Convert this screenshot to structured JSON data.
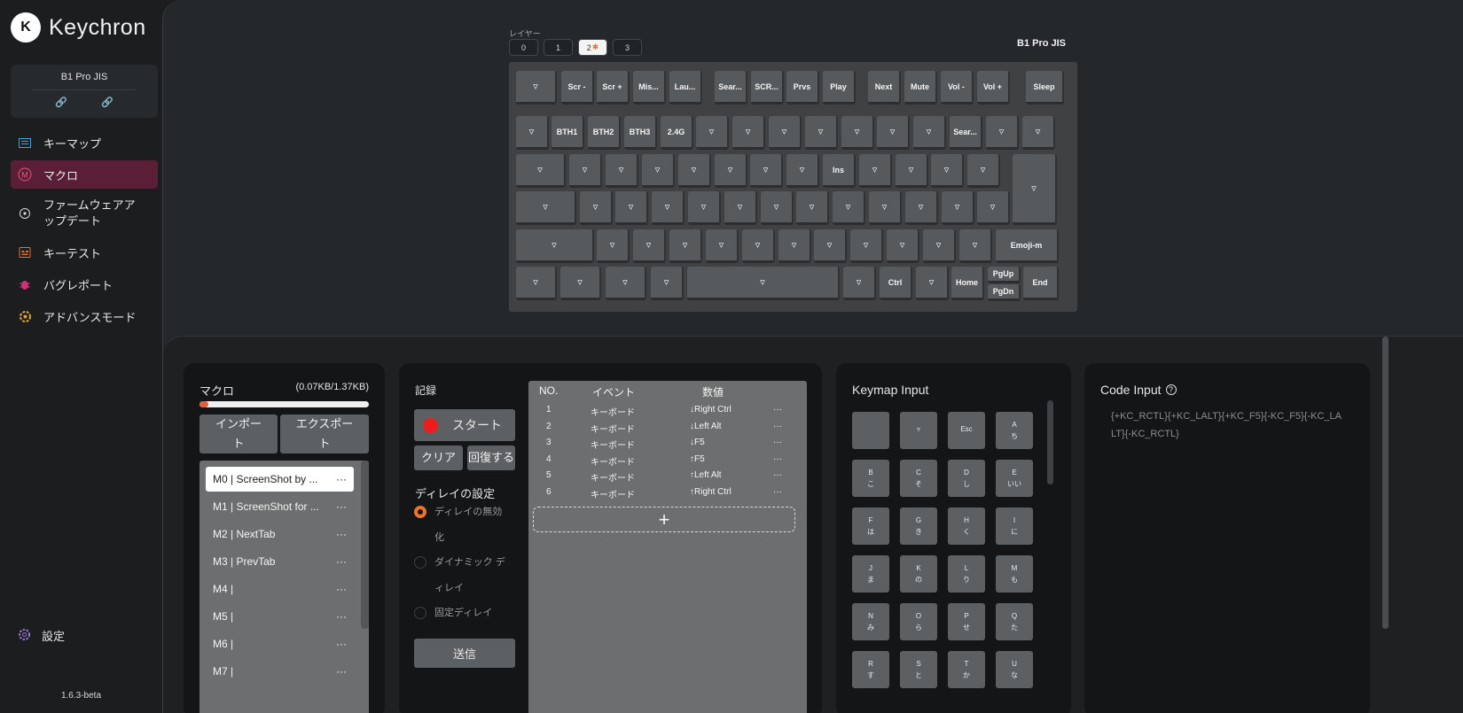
{
  "app": {
    "logo_glyph": "K",
    "brand": "Keychron",
    "version": "1.6.3-beta"
  },
  "device": {
    "name": "B1 Pro JIS",
    "link_icon_1": "🔗",
    "link_icon_2": "🔗"
  },
  "nav": [
    {
      "label": "キーマップ",
      "icon": "keymap-icon"
    },
    {
      "label": "マクロ",
      "icon": "macro-icon"
    },
    {
      "label": "ファームウェアアップデート",
      "icon": "firmware-icon"
    },
    {
      "label": "キーテスト",
      "icon": "keytest-icon"
    },
    {
      "label": "バグレポート",
      "icon": "bug-icon"
    },
    {
      "label": "アドバンスモード",
      "icon": "advanced-icon"
    }
  ],
  "settings_label": "設定",
  "layers": {
    "label": "レイヤー",
    "items": [
      "0",
      "1",
      "2",
      "3"
    ],
    "selected": "2",
    "modified_mark": "✱"
  },
  "board_title": "B1 Pro JIS",
  "keys": {
    "r1": [
      "▿",
      "Scr -",
      "Scr +",
      "Mis...",
      "Lau...",
      "Sear...",
      "SCR...",
      "Prvs",
      "Play",
      "Next",
      "Mute",
      "Vol -",
      "Vol +",
      "Sleep"
    ],
    "r2": [
      "▿",
      "BTH1",
      "BTH2",
      "BTH3",
      "2.4G",
      "▿",
      "▿",
      "▿",
      "▿",
      "▿",
      "▿",
      "▿",
      "Sear...",
      "▿",
      "▿"
    ],
    "r3": [
      "▿",
      "▿",
      "▿",
      "▿",
      "▿",
      "▿",
      "▿",
      "▿",
      "Ins",
      "▿",
      "▿",
      "▿",
      "▿"
    ],
    "enter": "▿",
    "r4": [
      "▿",
      "▿",
      "▿",
      "▿",
      "▿",
      "▿",
      "▿",
      "▿",
      "▿",
      "▿",
      "▿",
      "▿",
      "▿"
    ],
    "r5": [
      "▿",
      "▿",
      "▿",
      "▿",
      "▿",
      "▿",
      "▿",
      "▿",
      "▿",
      "▿",
      "▿",
      "▿",
      "Emoji-m"
    ],
    "r6": [
      "▿",
      "▿",
      "▿",
      "▿",
      "▿",
      "▿",
      "Ctrl",
      "▿",
      "Home",
      "PgUp",
      "PgDn",
      "End"
    ]
  },
  "macro": {
    "title": "マクロ",
    "size": "(0.07KB/1.37KB)",
    "usage_fraction": 0.05,
    "import_label": "インポート",
    "export_label": "エクスポート",
    "items": [
      {
        "name": "M0 | ScreenShot by ...",
        "more": "···"
      },
      {
        "name": "M1 | ScreenShot for ...",
        "more": "···"
      },
      {
        "name": "M2 | NextTab",
        "more": "···"
      },
      {
        "name": "M3 | PrevTab",
        "more": "···"
      },
      {
        "name": "M4 |",
        "more": "···"
      },
      {
        "name": "M5 |",
        "more": "···"
      },
      {
        "name": "M6 |",
        "more": "···"
      },
      {
        "name": "M7 |",
        "more": "···"
      }
    ]
  },
  "record": {
    "title": "記録",
    "start_label": "スタート",
    "clear_label": "クリア",
    "restore_label": "回復する",
    "delay_title": "ディレイの設定",
    "delay_options": [
      "ディレイの無効化",
      "ダイナミック ディレイ",
      "固定ディレイ"
    ],
    "send_label": "送信"
  },
  "events": {
    "headers": {
      "no": "NO.",
      "event": "イベント",
      "value": "数値"
    },
    "rows": [
      {
        "no": "1",
        "event": "キーボード",
        "value": "↓Right Ctrl",
        "more": "···"
      },
      {
        "no": "2",
        "event": "キーボード",
        "value": "↓Left Alt",
        "more": "···"
      },
      {
        "no": "3",
        "event": "キーボード",
        "value": "↓F5",
        "more": "···"
      },
      {
        "no": "4",
        "event": "キーボード",
        "value": "↑F5",
        "more": "···"
      },
      {
        "no": "5",
        "event": "キーボード",
        "value": "↑Left Alt",
        "more": "···"
      },
      {
        "no": "6",
        "event": "キーボード",
        "value": "↑Right Ctrl",
        "more": "···"
      }
    ],
    "add_glyph": "+"
  },
  "keymap_input": {
    "title": "Keymap Input",
    "keys": [
      [
        "",
        ""
      ],
      [
        "▿",
        ""
      ],
      [
        "Esc",
        ""
      ],
      [
        "A",
        "ち"
      ],
      [
        "B",
        "こ"
      ],
      [
        "C",
        "そ"
      ],
      [
        "D",
        "し"
      ],
      [
        "E",
        "いい"
      ],
      [
        "F",
        "は"
      ],
      [
        "G",
        "き"
      ],
      [
        "H",
        "く"
      ],
      [
        "I",
        "に"
      ],
      [
        "J",
        "ま"
      ],
      [
        "K",
        "の"
      ],
      [
        "L",
        "り"
      ],
      [
        "M",
        "も"
      ],
      [
        "N",
        "み"
      ],
      [
        "O",
        "ら"
      ],
      [
        "P",
        "せ"
      ],
      [
        "Q",
        "た"
      ],
      [
        "R",
        "す"
      ],
      [
        "S",
        "と"
      ],
      [
        "T",
        "か"
      ],
      [
        "U",
        "な"
      ]
    ]
  },
  "code_input": {
    "title": "Code Input",
    "help_glyph": "?",
    "code": "{+KC_RCTL}{+KC_LALT}{+KC_F5}{-KC_F5}{-KC_LALT}{-KC_RCTL}"
  }
}
